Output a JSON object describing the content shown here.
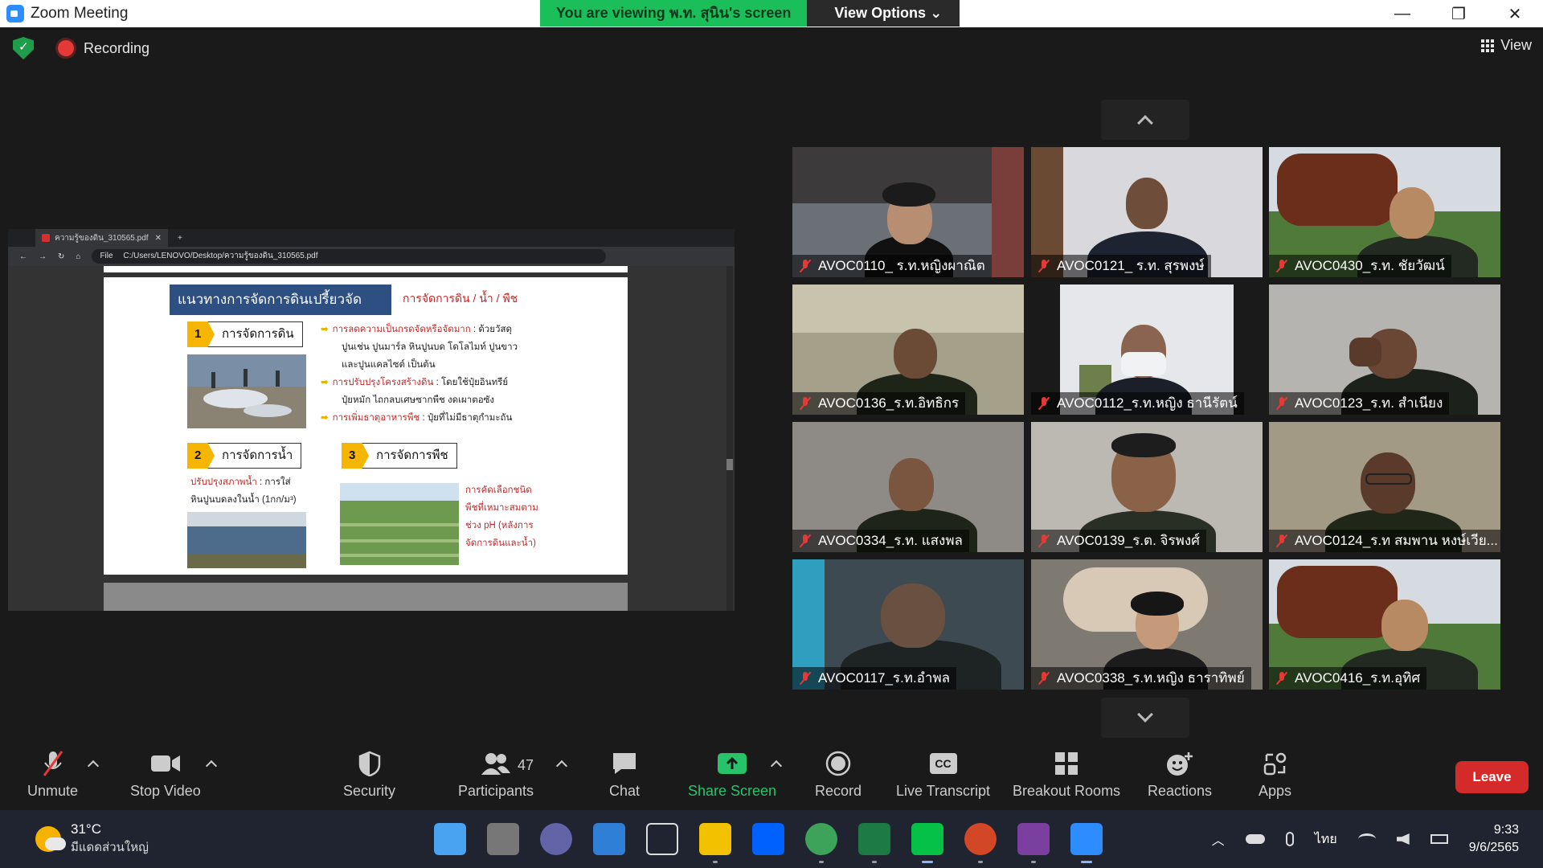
{
  "window": {
    "title": "Zoom Meeting"
  },
  "banner": {
    "viewing": "You are viewing พ.ท. สุนิน's screen",
    "view_options": "View Options ⌄"
  },
  "window_controls": {
    "minimize": "—",
    "restore": "❐",
    "close": "✕"
  },
  "top": {
    "recording": "Recording",
    "view": "View"
  },
  "shared_screen": {
    "tab_title": "ความรู้ของดิน_310565.pdf",
    "tab_close": "✕",
    "new_tab": "+",
    "address_label": "File",
    "address": "C:/Users/LENOVO/Desktop/ความรู้ของดิน_310565.pdf",
    "slide": {
      "heading": "แนวทางการจัดการดินเปรี้ยวจัด",
      "subheading": "การจัดการดิน / น้ำ / พืช",
      "step1": {
        "num": "1",
        "label": "การจัดการดิน"
      },
      "step2": {
        "num": "2",
        "label": "การจัดการน้ำ"
      },
      "step3": {
        "num": "3",
        "label": "การจัดการพืช"
      },
      "bullet1_title": "การลดความเป็นกรดจัดหรือจัดมาก",
      "bullet1_rest": " : ด้วยวัสดุ",
      "bullet1_line2": "ปูนเช่น ปูนมาร์ล หินปูนบด โดโลไมท์ ปูนขาว",
      "bullet1_line3": "และปูนแคลไซต์ เป็นต้น",
      "bullet2_title": "การปรับปรุงโครงสร้างดิน",
      "bullet2_rest": " : โดยใช้ปุ๋ยอินทรีย์",
      "bullet2_line2": "ปุ๋ยหมัก ไถกลบเศษซากพืช งดเผาตอซัง",
      "bullet3_title": "การเพิ่มธาตุอาหารพืช",
      "bullet3_rest": " : ปุ๋ยที่ไม่มีธาตุกำมะถัน",
      "water_title": "ปรับปรุงสภาพน้ำ",
      "water_rest": " : การใส่",
      "water_line2": "หินปูนบดลงในน้ำ (1กก/ม³)",
      "plant_line1": "การคัดเลือกชนิด",
      "plant_line2": "พืชที่เหมาะสมตาม",
      "plant_line3": "ช่วง pH (หลังการ",
      "plant_line4": "จัดการดินและน้ำ)"
    }
  },
  "participants_grid": [
    {
      "name": "AVOC0110_ ร.ท.หญิงผาณิต"
    },
    {
      "name": "AVOC0121_ ร.ท. สุรพงษ์"
    },
    {
      "name": "AVOC0430_ร.ท. ชัยวัฒน์"
    },
    {
      "name": "AVOC0136_ร.ท.อิทธิกร"
    },
    {
      "name": "AVOC0112_ร.ท.หญิง ธานีรัตน์"
    },
    {
      "name": "AVOC0123_ร.ท. สำเนียง"
    },
    {
      "name": "AVOC0334_ร.ท. แสงพล"
    },
    {
      "name": "AVOC0139_ร.ต. จิรพงศ์"
    },
    {
      "name": "AVOC0124_ร.ท สมพาน หงษ์เวีย..."
    },
    {
      "name": "AVOC0117_ร.ท.อำพล"
    },
    {
      "name": "AVOC0338_ร.ท.หญิง ธาราทิพย์"
    },
    {
      "name": "AVOC0416_ร.ท.อุทิศ"
    }
  ],
  "toolbar": {
    "unmute": "Unmute",
    "stop_video": "Stop Video",
    "security": "Security",
    "participants": "Participants",
    "participant_count": "47",
    "chat": "Chat",
    "share_screen": "Share Screen",
    "record": "Record",
    "live_transcript": "Live Transcript",
    "breakout_rooms": "Breakout Rooms",
    "reactions": "Reactions",
    "apps": "Apps",
    "leave": "Leave",
    "cc": "CC"
  },
  "taskbar": {
    "temperature": "31°C",
    "weather_desc": "มีแดดส่วนใหญ่",
    "language": "ไทย",
    "time": "9:33",
    "date": "9/6/2565",
    "up_arrow": "︿"
  },
  "colors": {
    "zoom_blue": "#2d8cff",
    "share_green": "#27c36b",
    "leave_red": "#d42a2a",
    "banner_green": "#1bbf5a"
  }
}
